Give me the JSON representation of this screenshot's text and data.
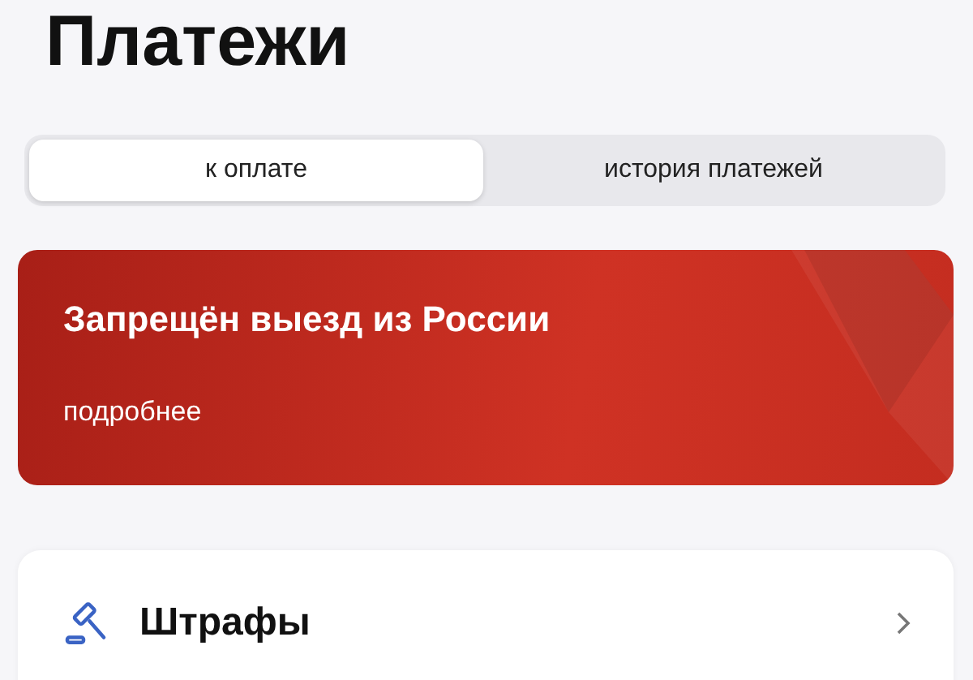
{
  "title": "Платежи",
  "tabs": [
    {
      "label": "к оплате",
      "selected": true
    },
    {
      "label": "история платежей",
      "selected": false
    }
  ],
  "banner": {
    "title": "Запрещён выезд из России",
    "link": "подробнее"
  },
  "sections": [
    {
      "title": "Штрафы"
    }
  ]
}
